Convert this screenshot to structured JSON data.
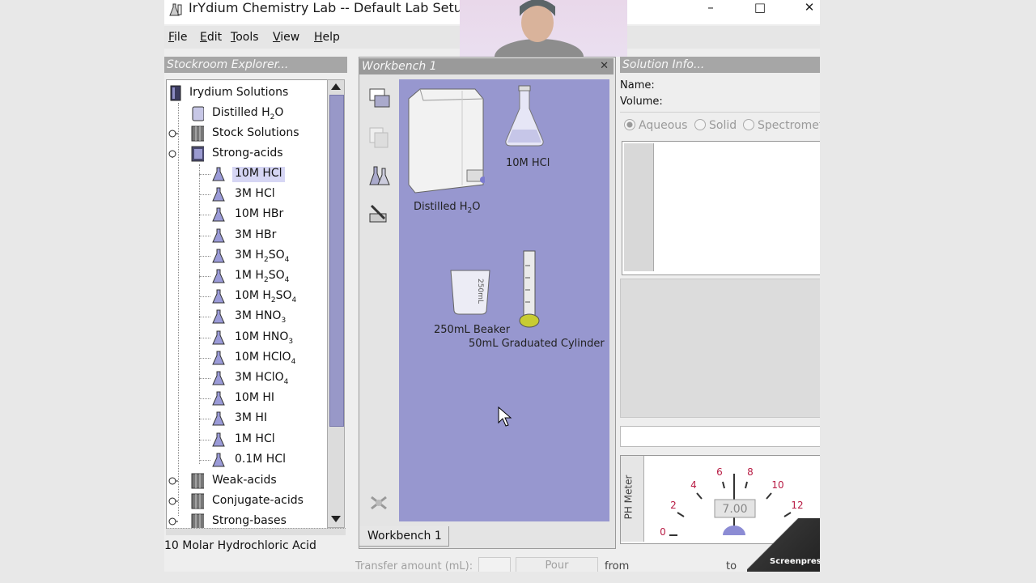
{
  "window": {
    "title": "IrYdium Chemistry Lab -- Default Lab Setup",
    "minimize": "–",
    "maximize": "□",
    "close": "✕"
  },
  "menu": [
    {
      "first": "F",
      "rest": "ile"
    },
    {
      "first": "E",
      "rest": "dit"
    },
    {
      "first": "T",
      "rest": "ools"
    },
    {
      "first": "V",
      "rest": "iew"
    },
    {
      "first": "H",
      "rest": "elp"
    }
  ],
  "stockroom": {
    "title": "Stockroom Explorer...",
    "root": "Irydium Solutions",
    "nodes": {
      "distilled": {
        "text": "Distilled H",
        "sub": "2",
        "tail": "O"
      },
      "stock": "Stock Solutions",
      "strong_acids": "Strong-acids",
      "weak_acids": "Weak-acids",
      "conjugate_acids": "Conjugate-acids",
      "strong_bases": "Strong-bases"
    },
    "acids": [
      {
        "text": "10M HCl",
        "sub": "",
        "tail": "",
        "selected": true
      },
      {
        "text": "3M HCl",
        "sub": "",
        "tail": ""
      },
      {
        "text": "10M HBr",
        "sub": "",
        "tail": ""
      },
      {
        "text": "3M HBr",
        "sub": "",
        "tail": ""
      },
      {
        "text": "3M H",
        "sub": "2",
        "tail": "SO",
        "sub2": "4"
      },
      {
        "text": "1M H",
        "sub": "2",
        "tail": "SO",
        "sub2": "4"
      },
      {
        "text": "10M H",
        "sub": "2",
        "tail": "SO",
        "sub2": "4"
      },
      {
        "text": "3M HNO",
        "sub": "3",
        "tail": ""
      },
      {
        "text": "10M HNO",
        "sub": "3",
        "tail": ""
      },
      {
        "text": "10M HClO",
        "sub": "4",
        "tail": ""
      },
      {
        "text": "3M HClO",
        "sub": "4",
        "tail": ""
      },
      {
        "text": "10M HI",
        "sub": "",
        "tail": ""
      },
      {
        "text": "3M HI",
        "sub": "",
        "tail": ""
      },
      {
        "text": "1M HCl",
        "sub": "",
        "tail": ""
      },
      {
        "text": "0.1M HCl",
        "sub": "",
        "tail": ""
      }
    ],
    "status": "10 Molar Hydrochloric Acid"
  },
  "workbench": {
    "title": "Workbench 1",
    "close": "✕",
    "tab": "Workbench 1",
    "items": {
      "distilled": {
        "text": "Distilled H",
        "sub": "2",
        "tail": "O"
      },
      "hcl": "10M HCl",
      "beaker": "250mL Beaker",
      "beaker_mark": "250mL",
      "cylinder": "50mL Graduated Cylinder"
    }
  },
  "solution_info": {
    "title": "Solution Info...",
    "name_label": "Name:",
    "volume_label": "Volume:",
    "radios": [
      "Aqueous",
      "Solid",
      "Spectrometer"
    ],
    "ph_meter": {
      "label": "PH Meter",
      "value": "7.00",
      "ticks": [
        "0",
        "2",
        "4",
        "6",
        "8",
        "10",
        "12"
      ]
    }
  },
  "bottom": {
    "transfer_label": "Transfer amount (mL):",
    "pour": "Pour",
    "from": "from",
    "to": "to",
    "screenpresso": "Screenpresso"
  }
}
